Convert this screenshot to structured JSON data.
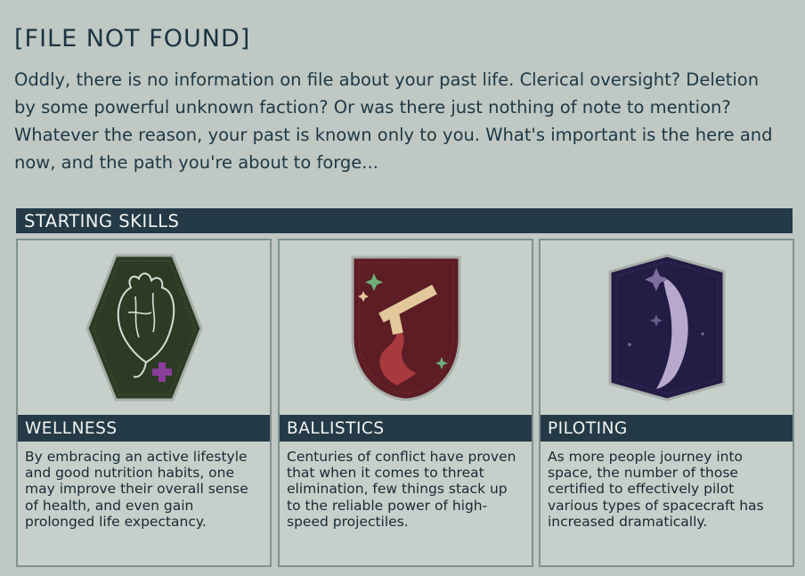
{
  "header": {
    "title": "[FILE NOT FOUND]",
    "description": "Oddly, there is no information on file about your past life. Clerical oversight? Deletion by some powerful unknown faction? Or was there just nothing of note to mention? Whatever the reason, your past is known only to you. What's important is the here and now, and the path you're about to forge..."
  },
  "skills_section": {
    "label": "STARTING SKILLS",
    "skills": [
      {
        "name": "WELLNESS",
        "icon": "anatomical-heart-icon",
        "badge_color": "#2b3a22",
        "description": "By embracing an active lifestyle and good nutrition habits, one may improve their overall sense of health, and even gain prolonged life expectancy."
      },
      {
        "name": "BALLISTICS",
        "icon": "pistol-tentacle-icon",
        "badge_color": "#5a1c24",
        "description": "Centuries of conflict have proven that when it comes to threat elimination, few things stack up to the reliable power of high-speed projectiles."
      },
      {
        "name": "PILOTING",
        "icon": "spaceship-trail-icon",
        "badge_color": "#241d42",
        "description": "As more people journey into space, the number of those certified to effectively pilot various types of spacecraft has increased dramatically."
      }
    ]
  },
  "colors": {
    "background": "#bfc8c3",
    "header_bar": "#243a47",
    "text": "#1d3844",
    "card_border": "#7f9190"
  }
}
